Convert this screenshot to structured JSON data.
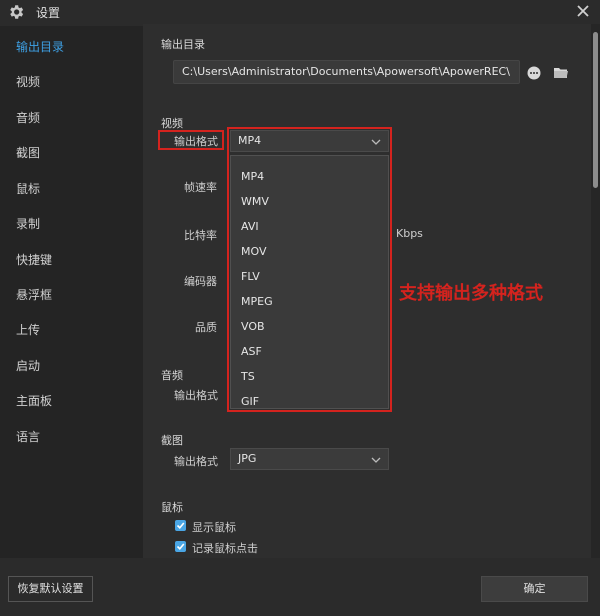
{
  "window": {
    "title": "设置"
  },
  "sidebar": {
    "items": [
      {
        "label": "输出目录",
        "active": true
      },
      {
        "label": "视频"
      },
      {
        "label": "音频"
      },
      {
        "label": "截图"
      },
      {
        "label": "鼠标"
      },
      {
        "label": "录制"
      },
      {
        "label": "快捷键"
      },
      {
        "label": "悬浮框"
      },
      {
        "label": "上传"
      },
      {
        "label": "启动"
      },
      {
        "label": "主面板"
      },
      {
        "label": "语言"
      }
    ]
  },
  "output_dir": {
    "heading": "输出目录",
    "path": "C:\\Users\\Administrator\\Documents\\Apowersoft\\ApowerREC\\"
  },
  "video": {
    "heading": "视频",
    "format_label": "输出格式",
    "format_value": "MP4",
    "framerate_label": "帧速率",
    "bitrate_label": "比特率",
    "bitrate_unit": "Kbps",
    "encoder_label": "编码器",
    "quality_label": "品质",
    "format_options": [
      "MP4",
      "WMV",
      "AVI",
      "MOV",
      "FLV",
      "MPEG",
      "VOB",
      "ASF",
      "TS",
      "GIF"
    ]
  },
  "audio": {
    "heading": "音频",
    "format_label": "输出格式"
  },
  "screenshot": {
    "heading": "截图",
    "format_label": "输出格式",
    "format_value": "JPG"
  },
  "mouse": {
    "heading": "鼠标",
    "show_cursor": {
      "label": "显示鼠标",
      "checked": true
    },
    "record_clicks": {
      "label": "记录鼠标点击",
      "checked": true
    }
  },
  "annotation": {
    "text": "支持输出多种格式",
    "color": "#d4231e"
  },
  "footer": {
    "reset_label": "恢复默认设置",
    "ok_label": "确定"
  },
  "colors": {
    "accent": "#3ea0e4",
    "checkbox": "#4aa6e5"
  }
}
